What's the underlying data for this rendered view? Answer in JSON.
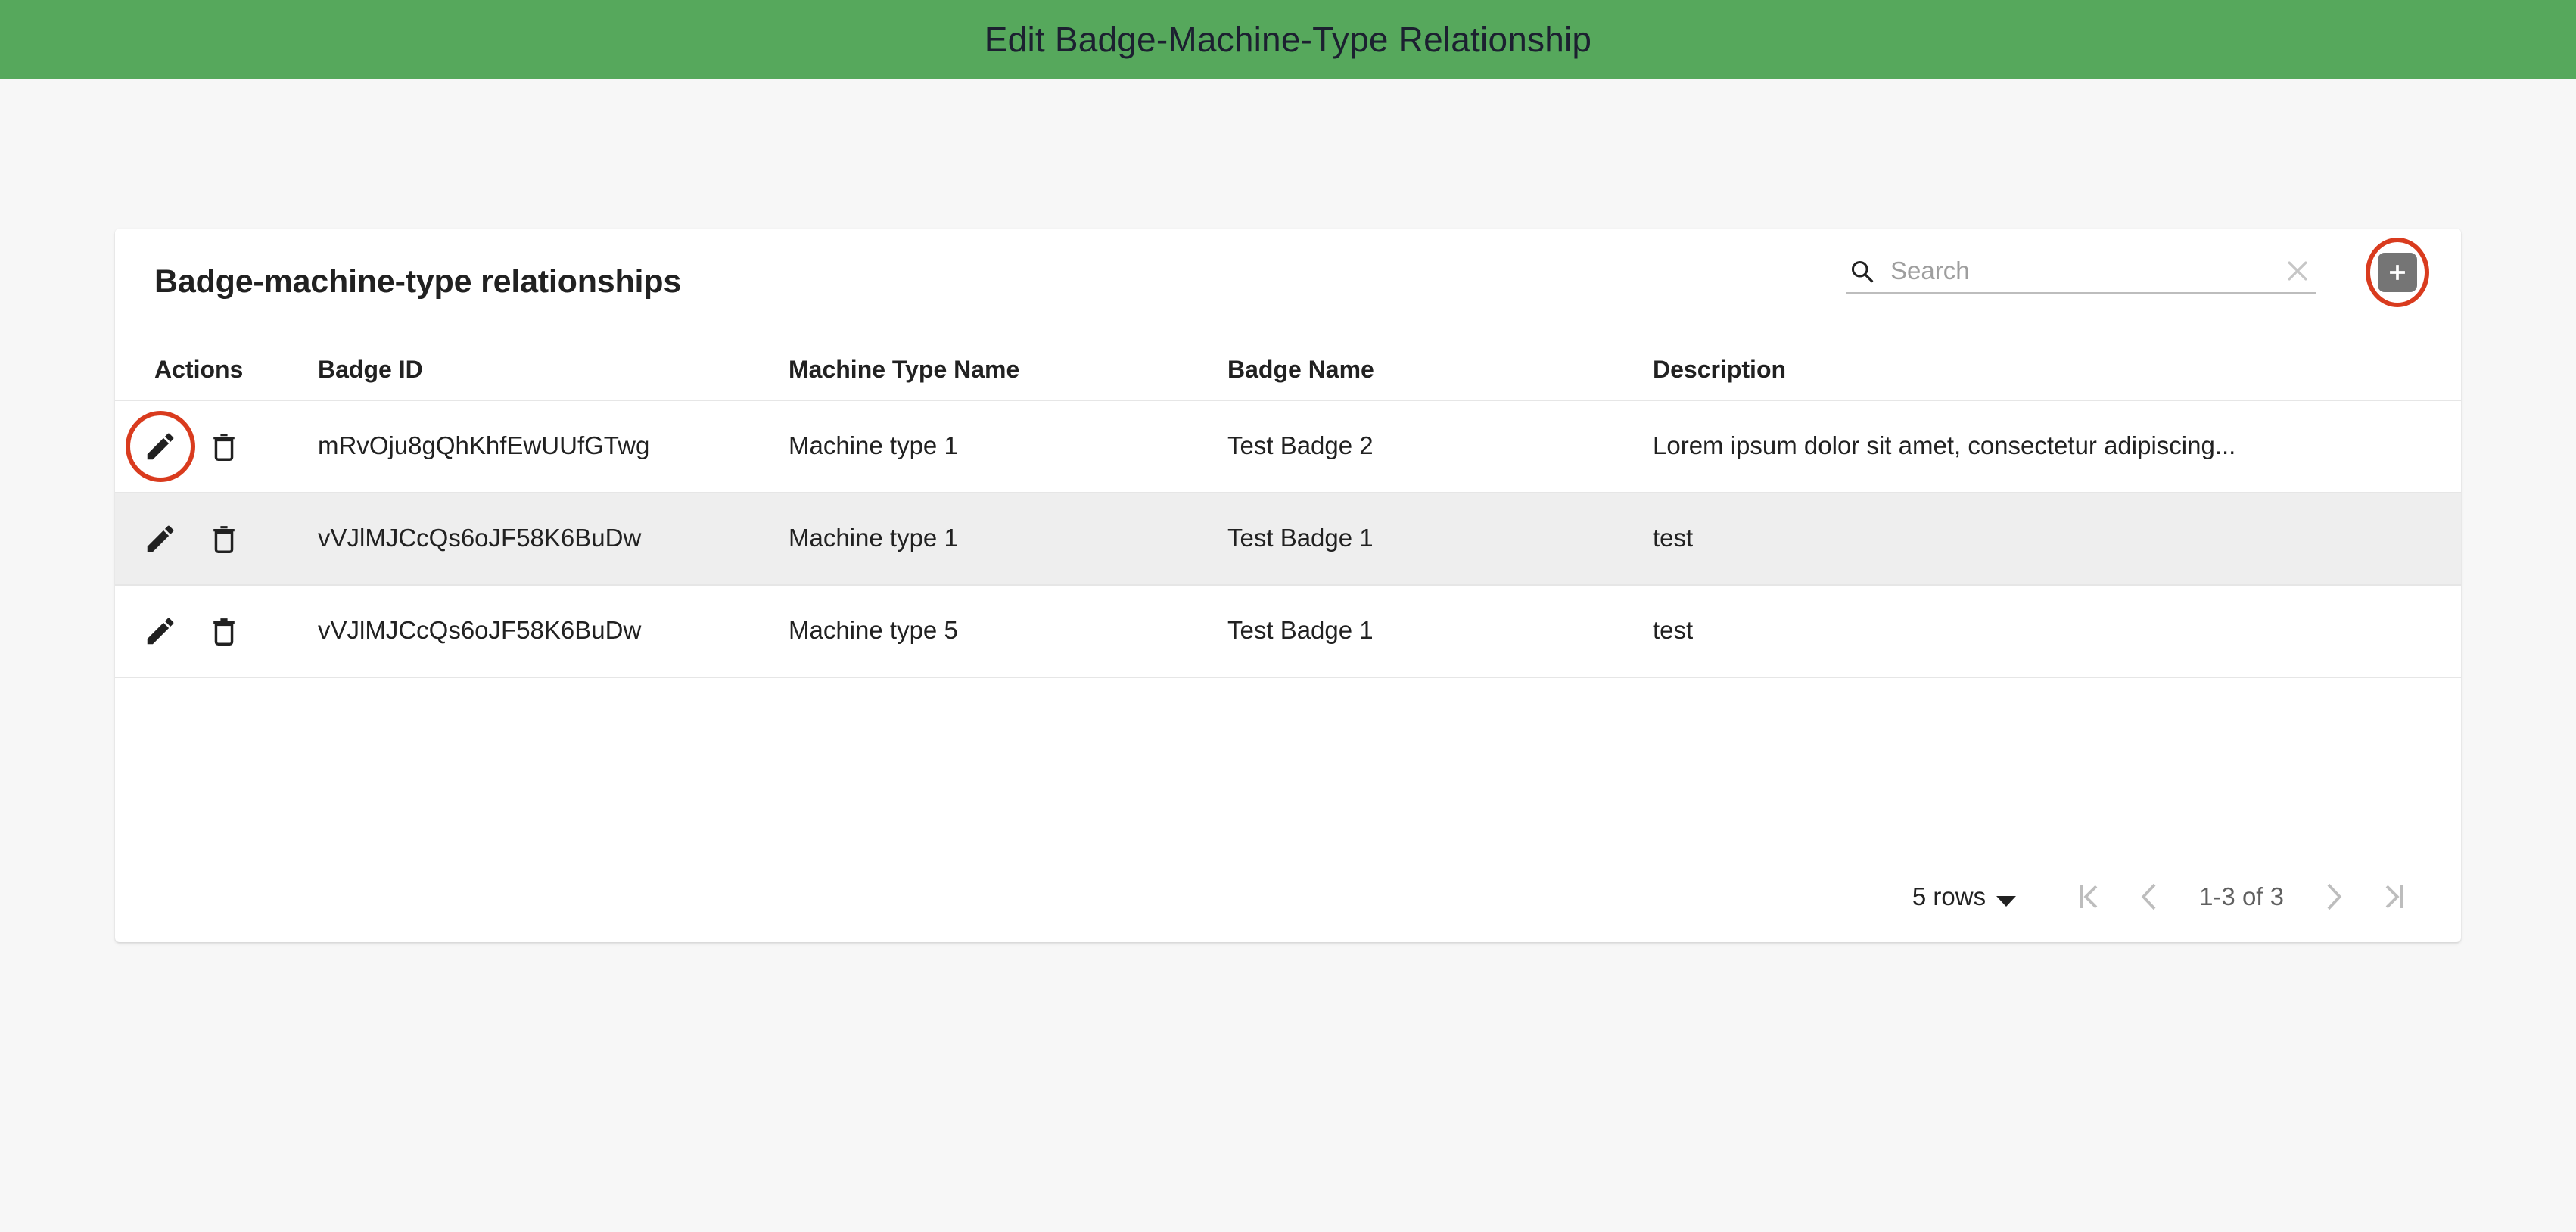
{
  "banner": {
    "title": "Edit Badge-Machine-Type Relationship",
    "color": "#56a85c"
  },
  "card": {
    "title": "Badge-machine-type relationships"
  },
  "search": {
    "placeholder": "Search",
    "value": "",
    "icon": "search-icon",
    "clear_icon": "close-icon"
  },
  "add_button": {
    "icon": "plus-icon",
    "label": "",
    "annotation_color": "#d93b1e"
  },
  "table": {
    "columns": [
      "Actions",
      "Badge ID",
      "Machine Type Name",
      "Badge Name",
      "Description"
    ],
    "row_actions": {
      "edit_icon": "pencil-icon",
      "delete_icon": "trash-icon"
    },
    "rows": [
      {
        "badge_id": "mRvOju8gQhKhfEwUUfGTwg",
        "machine_type_name": "Machine type 1",
        "badge_name": "Test Badge 2",
        "description": "Lorem ipsum dolor sit amet, consectetur adipiscing..."
      },
      {
        "badge_id": "vVJlMJCcQs6oJF58K6BuDw",
        "machine_type_name": "Machine type 1",
        "badge_name": "Test Badge 1",
        "description": "test"
      },
      {
        "badge_id": "vVJlMJCcQs6oJF58K6BuDw",
        "machine_type_name": "Machine type 5",
        "badge_name": "Test Badge 1",
        "description": "test"
      }
    ]
  },
  "paginator": {
    "rows_per_page_label": "5 rows",
    "range_label": "1-3 of 3",
    "first_icon": "first-page-icon",
    "prev_icon": "chevron-left-icon",
    "next_icon": "chevron-right-icon",
    "last_icon": "last-page-icon"
  }
}
